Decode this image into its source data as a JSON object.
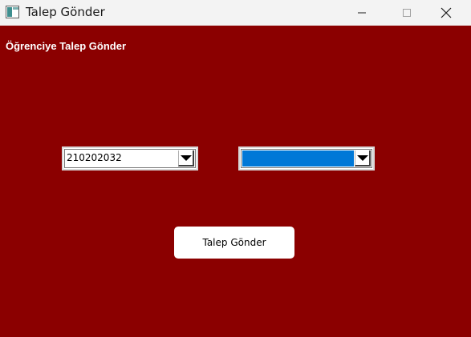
{
  "window": {
    "title": "Talep Gönder",
    "icon": "app-window-icon",
    "controls": [
      "minimize-icon",
      "maximize-icon",
      "close-icon"
    ]
  },
  "main": {
    "heading": "Öğrenciye Talep Gönder",
    "background_color": "#8b0000",
    "student_combo": {
      "value": "210202032"
    },
    "request_combo": {
      "value": "",
      "highlight_color": "#0078d7"
    },
    "send_button": {
      "label": "Talep Gönder"
    }
  }
}
